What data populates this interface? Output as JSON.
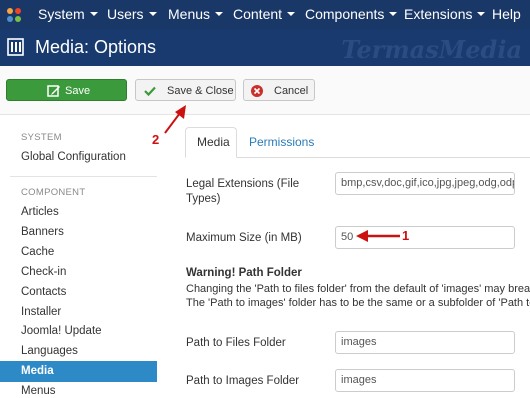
{
  "topmenu": {
    "items": [
      {
        "label": "System"
      },
      {
        "label": "Users"
      },
      {
        "label": "Menus"
      },
      {
        "label": "Content"
      },
      {
        "label": "Components"
      },
      {
        "label": "Extensions"
      },
      {
        "label": "Help"
      }
    ]
  },
  "header": {
    "title": "Media: Options",
    "watermark": "TermasMedia"
  },
  "toolbar": {
    "save_label": "Save",
    "save_close_label": "Save & Close",
    "cancel_label": "Cancel"
  },
  "sidebar": {
    "system_heading": "SYSTEM",
    "global_config": "Global Configuration",
    "component_heading": "COMPONENT",
    "items": [
      {
        "label": "Articles"
      },
      {
        "label": "Banners"
      },
      {
        "label": "Cache"
      },
      {
        "label": "Check-in"
      },
      {
        "label": "Contacts"
      },
      {
        "label": "Installer"
      },
      {
        "label": "Joomla! Update"
      },
      {
        "label": "Languages"
      },
      {
        "label": "Media"
      },
      {
        "label": "Menus"
      }
    ],
    "active_item": "Media"
  },
  "tabs": [
    {
      "label": "Media",
      "active": true
    },
    {
      "label": "Permissions",
      "active": false
    }
  ],
  "form": {
    "legal_extensions_label_line1": "Legal Extensions (File",
    "legal_extensions_label_line2": "Types)",
    "legal_extensions_value": "bmp,csv,doc,gif,ico,jpg,jpeg,odg,odp",
    "max_size_label": "Maximum Size (in MB)",
    "max_size_value": "50",
    "warning_title": "Warning! Path Folder",
    "warning_line1": "Changing the 'Path to files folder' from the default of 'images' may break",
    "warning_line2": "The 'Path to images' folder has to be the same or a subfolder of 'Path to",
    "path_files_label": "Path to Files Folder",
    "path_files_value": "images",
    "path_images_label": "Path to Images Folder",
    "path_images_value": "images"
  },
  "annotations": {
    "one": "1",
    "two": "2"
  },
  "colors": {
    "topbar": "#1a3867",
    "header": "#183a6e",
    "save_green": "#3b9a3b",
    "active_blue": "#2d8ac7",
    "link_blue": "#2a7ab7",
    "annotation_red": "#cc1111"
  },
  "icons": {
    "logo": "joomla-logo-icon",
    "header": "media-options-icon",
    "save": "edit-icon",
    "save_close": "check-icon",
    "cancel": "cancel-icon"
  }
}
